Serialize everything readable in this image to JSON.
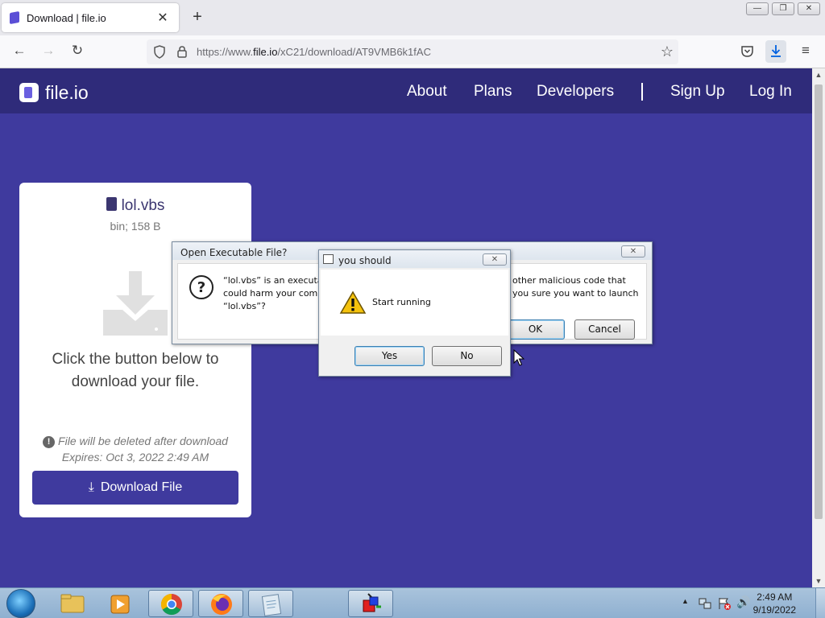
{
  "browser": {
    "tab_title": "Download | file.io",
    "tab_close": "✕",
    "new_tab": "+",
    "url_prefix": "https://www.",
    "url_domain": "file.io",
    "url_path": "/xC21/download/AT9VMB6k1fAC",
    "win_min": "—",
    "win_restore": "❐",
    "win_close": "✕"
  },
  "site": {
    "logo": "file.io",
    "nav": [
      "About",
      "Plans",
      "Developers",
      "Sign Up",
      "Log In"
    ]
  },
  "file_card": {
    "filename": "lol.vbs",
    "meta": "bin; 158 B",
    "instruction": "Click the button below to download your file.",
    "note_line1": "File will be deleted after download",
    "note_line2": "Expires: Oct 3, 2022 2:49 AM",
    "download_label": "Download File"
  },
  "dialog_exec": {
    "title": "Open Executable File?",
    "text_left": "“lol.vbs” is an executable file. Executable files may contain viruses or other malicious code that could harm your computer. Use caution when opening this file. Are you sure you want to launch “lol.vbs”?",
    "line1_left": "“lol.vbs” is an executab",
    "line2_left": "could harm your comp",
    "line3_left": "“lol.vbs”?",
    "line1_right": "other malicious code that",
    "line2_right": "you sure you want to launch",
    "ok_label": "OK",
    "cancel_label": "Cancel"
  },
  "dialog_msg": {
    "title": "you should",
    "message": "Start running",
    "yes_label": "Yes",
    "no_label": "No"
  },
  "taskbar": {
    "time": "2:49 AM",
    "date": "9/19/2022"
  },
  "colors": {
    "page_bg": "#3f3a9e",
    "header_bg": "#2f2b7a",
    "button_bg": "#3f3a9e"
  }
}
